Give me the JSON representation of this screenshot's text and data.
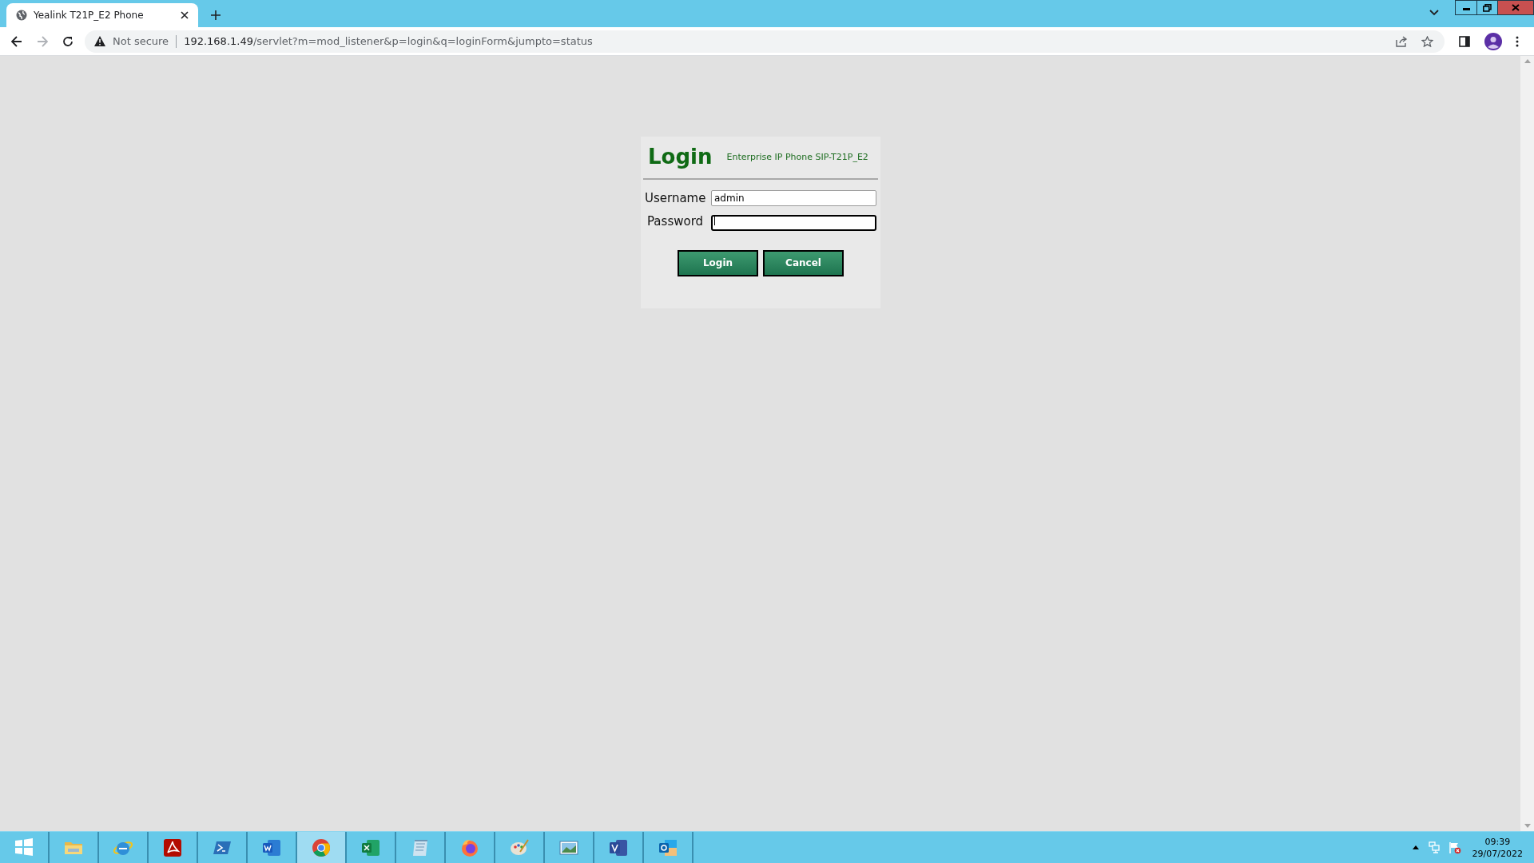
{
  "browser": {
    "tab": {
      "title": "Yealink T21P_E2 Phone",
      "selected": true
    },
    "address_bar": {
      "security": "Not secure",
      "host": "192.168.1.49",
      "path": "/servlet?m=mod_listener&p=login&q=loginForm&jumpto=status"
    }
  },
  "login": {
    "title": "Login",
    "subtitle": "Enterprise IP Phone SIP-T21P_E2",
    "fields": [
      {
        "label": "Username",
        "value": "admin",
        "focused": false
      },
      {
        "label": "Password",
        "focused": true
      }
    ],
    "buttons": [
      "Login",
      "Cancel"
    ]
  },
  "taskbar": {
    "items": [
      {
        "kind": "start",
        "selected": false
      },
      {
        "kind": "folder",
        "selected": false
      },
      {
        "kind": "ie",
        "selected": false
      },
      {
        "kind": "pdf",
        "selected": false
      },
      {
        "kind": "shell",
        "selected": false
      },
      {
        "kind": "word",
        "selected": false
      },
      {
        "kind": "chrome",
        "selected": true
      },
      {
        "kind": "excel",
        "selected": false
      },
      {
        "kind": "notepad",
        "selected": false
      },
      {
        "kind": "firefox",
        "selected": false
      },
      {
        "kind": "paint",
        "selected": false
      },
      {
        "kind": "photo",
        "selected": false
      },
      {
        "kind": "visio",
        "selected": false
      },
      {
        "kind": "outlook",
        "selected": false
      }
    ],
    "clock": {
      "time": "09:39",
      "date": "29/07/2022"
    }
  }
}
